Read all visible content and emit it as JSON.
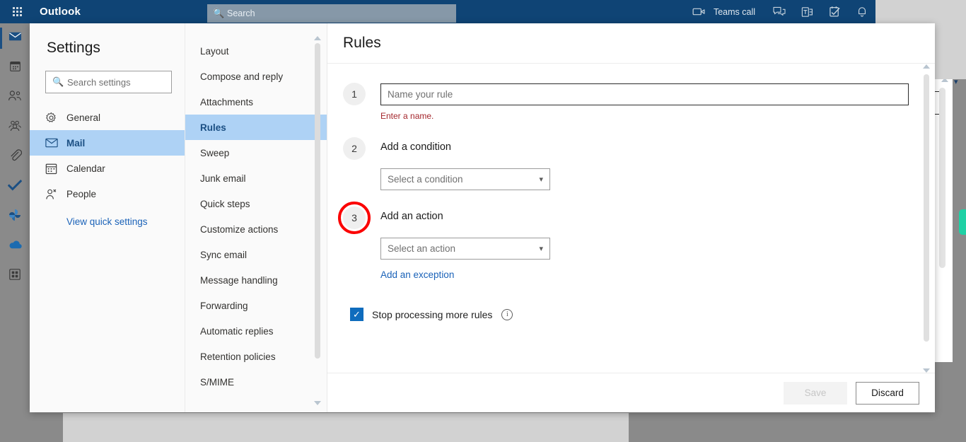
{
  "appbar": {
    "waffle_name": "app-launcher",
    "brand": "Outlook",
    "search_placeholder": "Search",
    "teams_call_label": "Teams call",
    "icons": [
      {
        "name": "video-camera-icon"
      },
      {
        "name": "chat-icon"
      },
      {
        "name": "teams-icon"
      },
      {
        "name": "tasks-icon"
      },
      {
        "name": "notifications-bell-icon"
      }
    ]
  },
  "rail": {
    "items": [
      {
        "name": "mail-icon",
        "label": "Mail",
        "active": true
      },
      {
        "name": "calendar-icon",
        "label": "Calendar",
        "active": false
      },
      {
        "name": "people-icon",
        "label": "People",
        "active": false
      },
      {
        "name": "groups-icon",
        "label": "Groups",
        "active": false
      },
      {
        "name": "files-attachment-icon",
        "label": "Files",
        "active": false
      },
      {
        "name": "to-do-check-icon",
        "label": "To Do",
        "active": false
      },
      {
        "name": "office-flower-icon",
        "label": "Office",
        "active": false
      },
      {
        "name": "onedrive-cloud-icon",
        "label": "OneDrive",
        "active": false
      },
      {
        "name": "all-apps-icon",
        "label": "All apps",
        "active": false
      }
    ]
  },
  "settings": {
    "title": "Settings",
    "search_placeholder": "Search settings",
    "items": [
      {
        "label": "General",
        "icon": "gear-icon",
        "selected": false
      },
      {
        "label": "Mail",
        "icon": "envelope-icon",
        "selected": true
      },
      {
        "label": "Calendar",
        "icon": "calendar-icon",
        "selected": false
      },
      {
        "label": "People",
        "icon": "person-icon",
        "selected": false
      }
    ],
    "quick_settings_link": "View quick settings"
  },
  "categories": {
    "items": [
      {
        "label": "Layout",
        "selected": false
      },
      {
        "label": "Compose and reply",
        "selected": false
      },
      {
        "label": "Attachments",
        "selected": false
      },
      {
        "label": "Rules",
        "selected": true
      },
      {
        "label": "Sweep",
        "selected": false
      },
      {
        "label": "Junk email",
        "selected": false
      },
      {
        "label": "Quick steps",
        "selected": false
      },
      {
        "label": "Customize actions",
        "selected": false
      },
      {
        "label": "Sync email",
        "selected": false
      },
      {
        "label": "Message handling",
        "selected": false
      },
      {
        "label": "Forwarding",
        "selected": false
      },
      {
        "label": "Automatic replies",
        "selected": false
      },
      {
        "label": "Retention policies",
        "selected": false
      },
      {
        "label": "S/MIME",
        "selected": false
      }
    ]
  },
  "rules": {
    "page_title": "Rules",
    "step1": {
      "number": "1",
      "input_placeholder": "Name your rule",
      "input_value": "",
      "error": "Enter a name."
    },
    "step2": {
      "number": "2",
      "label": "Add a condition",
      "dropdown_value": "Select a condition"
    },
    "step3": {
      "number": "3",
      "label": "Add an action",
      "dropdown_value": "Select an action",
      "exception_link": "Add an exception",
      "highlight_color": "#fb0000"
    },
    "checkbox": {
      "label": "Stop processing more rules",
      "checked": true,
      "info_icon": "info-icon"
    },
    "footer": {
      "save_label": "Save",
      "save_disabled": true,
      "discard_label": "Discard"
    }
  },
  "colors": {
    "appbar": "#0f4475",
    "selection": "#aed2f5",
    "link": "#1a62b8",
    "error": "#a4262c",
    "accent_check": "#0f6cbd",
    "highlight": "#fb0000"
  }
}
